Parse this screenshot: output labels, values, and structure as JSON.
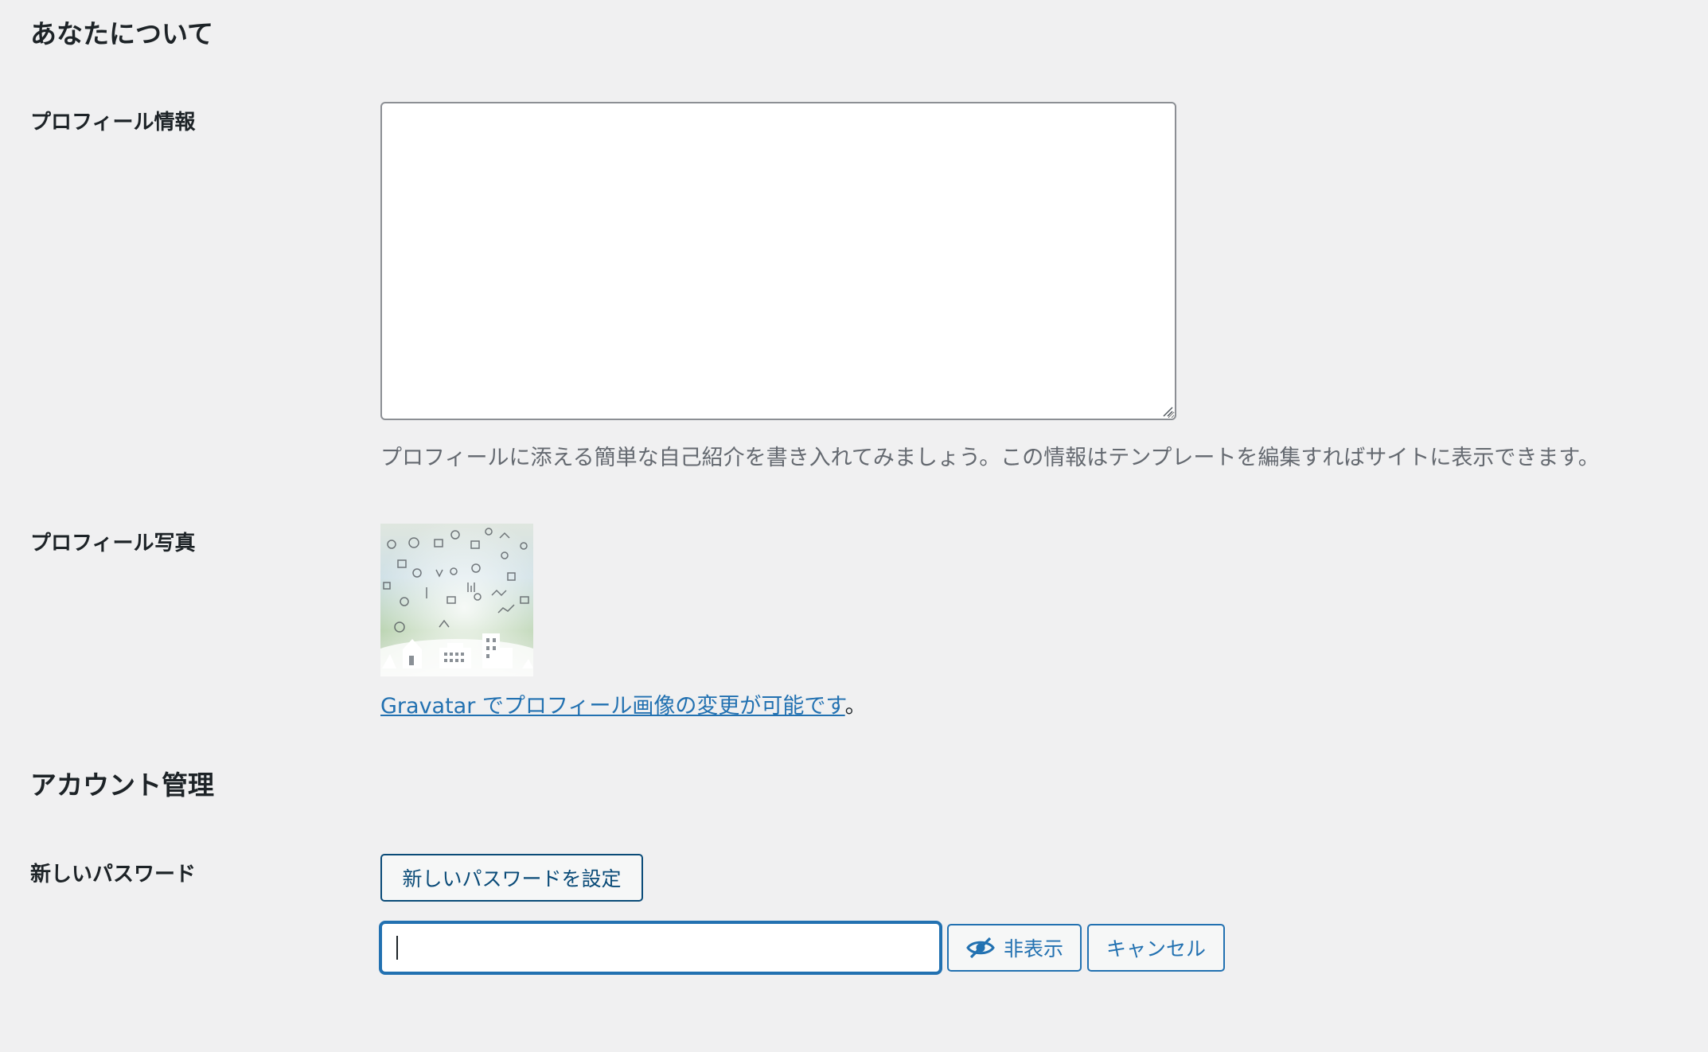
{
  "about_section": {
    "title": "あなたについて",
    "bio_label": "プロフィール情報",
    "bio_value": "",
    "bio_description": "プロフィールに添える簡単な自己紹介を書き入れてみましょう。この情報はテンプレートを編集すればサイトに表示できます。",
    "photo_label": "プロフィール写真",
    "gravatar_link_text": "Gravatar でプロフィール画像の変更が可能です",
    "gravatar_suffix": "。"
  },
  "account_section": {
    "title": "アカウント管理",
    "new_password_label": "新しいパスワード",
    "set_password_button": "新しいパスワードを設定",
    "password_value": "",
    "hide_button": "非表示",
    "cancel_button": "キャンセル"
  },
  "icons": {
    "hide_button_icon": "eye-slash-icon",
    "avatar_image": "city-icons-avatar"
  },
  "colors": {
    "background": "#f0f0f1",
    "link": "#2271b1",
    "description": "#646970",
    "text": "#1d2327"
  }
}
